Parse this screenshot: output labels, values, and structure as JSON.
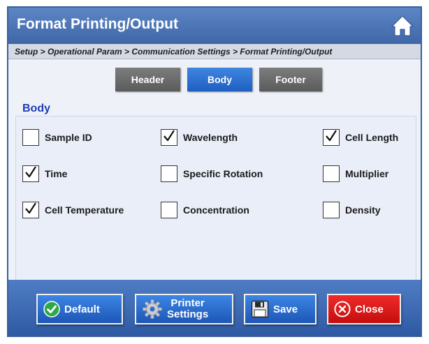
{
  "window": {
    "title": "Format Printing/Output"
  },
  "breadcrumb": "Setup > Operational Param > Communication Settings > Format Printing/Output",
  "tabs": [
    {
      "label": "Header",
      "active": false
    },
    {
      "label": "Body",
      "active": true
    },
    {
      "label": "Footer",
      "active": false
    }
  ],
  "section": {
    "title": "Body"
  },
  "checkboxes": [
    {
      "label": "Sample ID",
      "checked": false
    },
    {
      "label": "Wavelength",
      "checked": true
    },
    {
      "label": "Cell Length",
      "checked": true
    },
    {
      "label": "Time",
      "checked": true
    },
    {
      "label": "Specific Rotation",
      "checked": false
    },
    {
      "label": "Multiplier",
      "checked": false
    },
    {
      "label": "Cell Temperature",
      "checked": true
    },
    {
      "label": "Concentration",
      "checked": false
    },
    {
      "label": "Density",
      "checked": false
    }
  ],
  "buttons": {
    "default": "Default",
    "printer_line1": "Printer",
    "printer_line2": "Settings",
    "save": "Save",
    "close": "Close"
  },
  "colors": {
    "title_bar": "#4a74b6",
    "tab_active": "#2f72d0",
    "tab_inactive": "#6b6b6b",
    "section_title": "#1f3bb5",
    "close_button": "#e01818",
    "default_icon": "#2fa84a"
  },
  "icons": {
    "home": "home-icon",
    "default": "check-circle-icon",
    "printer_settings": "gear-icon",
    "save": "floppy-disk-icon",
    "close": "close-circle-icon",
    "checkbox_mark": "check-mark-icon"
  }
}
